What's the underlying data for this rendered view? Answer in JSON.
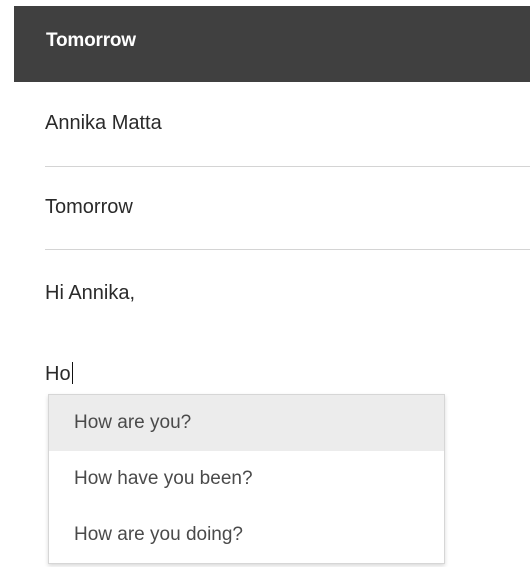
{
  "header": {
    "title": "Tomorrow"
  },
  "compose": {
    "to": "Annika Matta",
    "subject": "Tomorrow",
    "greeting": "Hi Annika,",
    "typed_text": "Ho"
  },
  "suggestions": {
    "items": [
      {
        "label": "How are you?",
        "selected": true
      },
      {
        "label": "How have you been?",
        "selected": false
      },
      {
        "label": "How are you doing?",
        "selected": false
      }
    ]
  }
}
